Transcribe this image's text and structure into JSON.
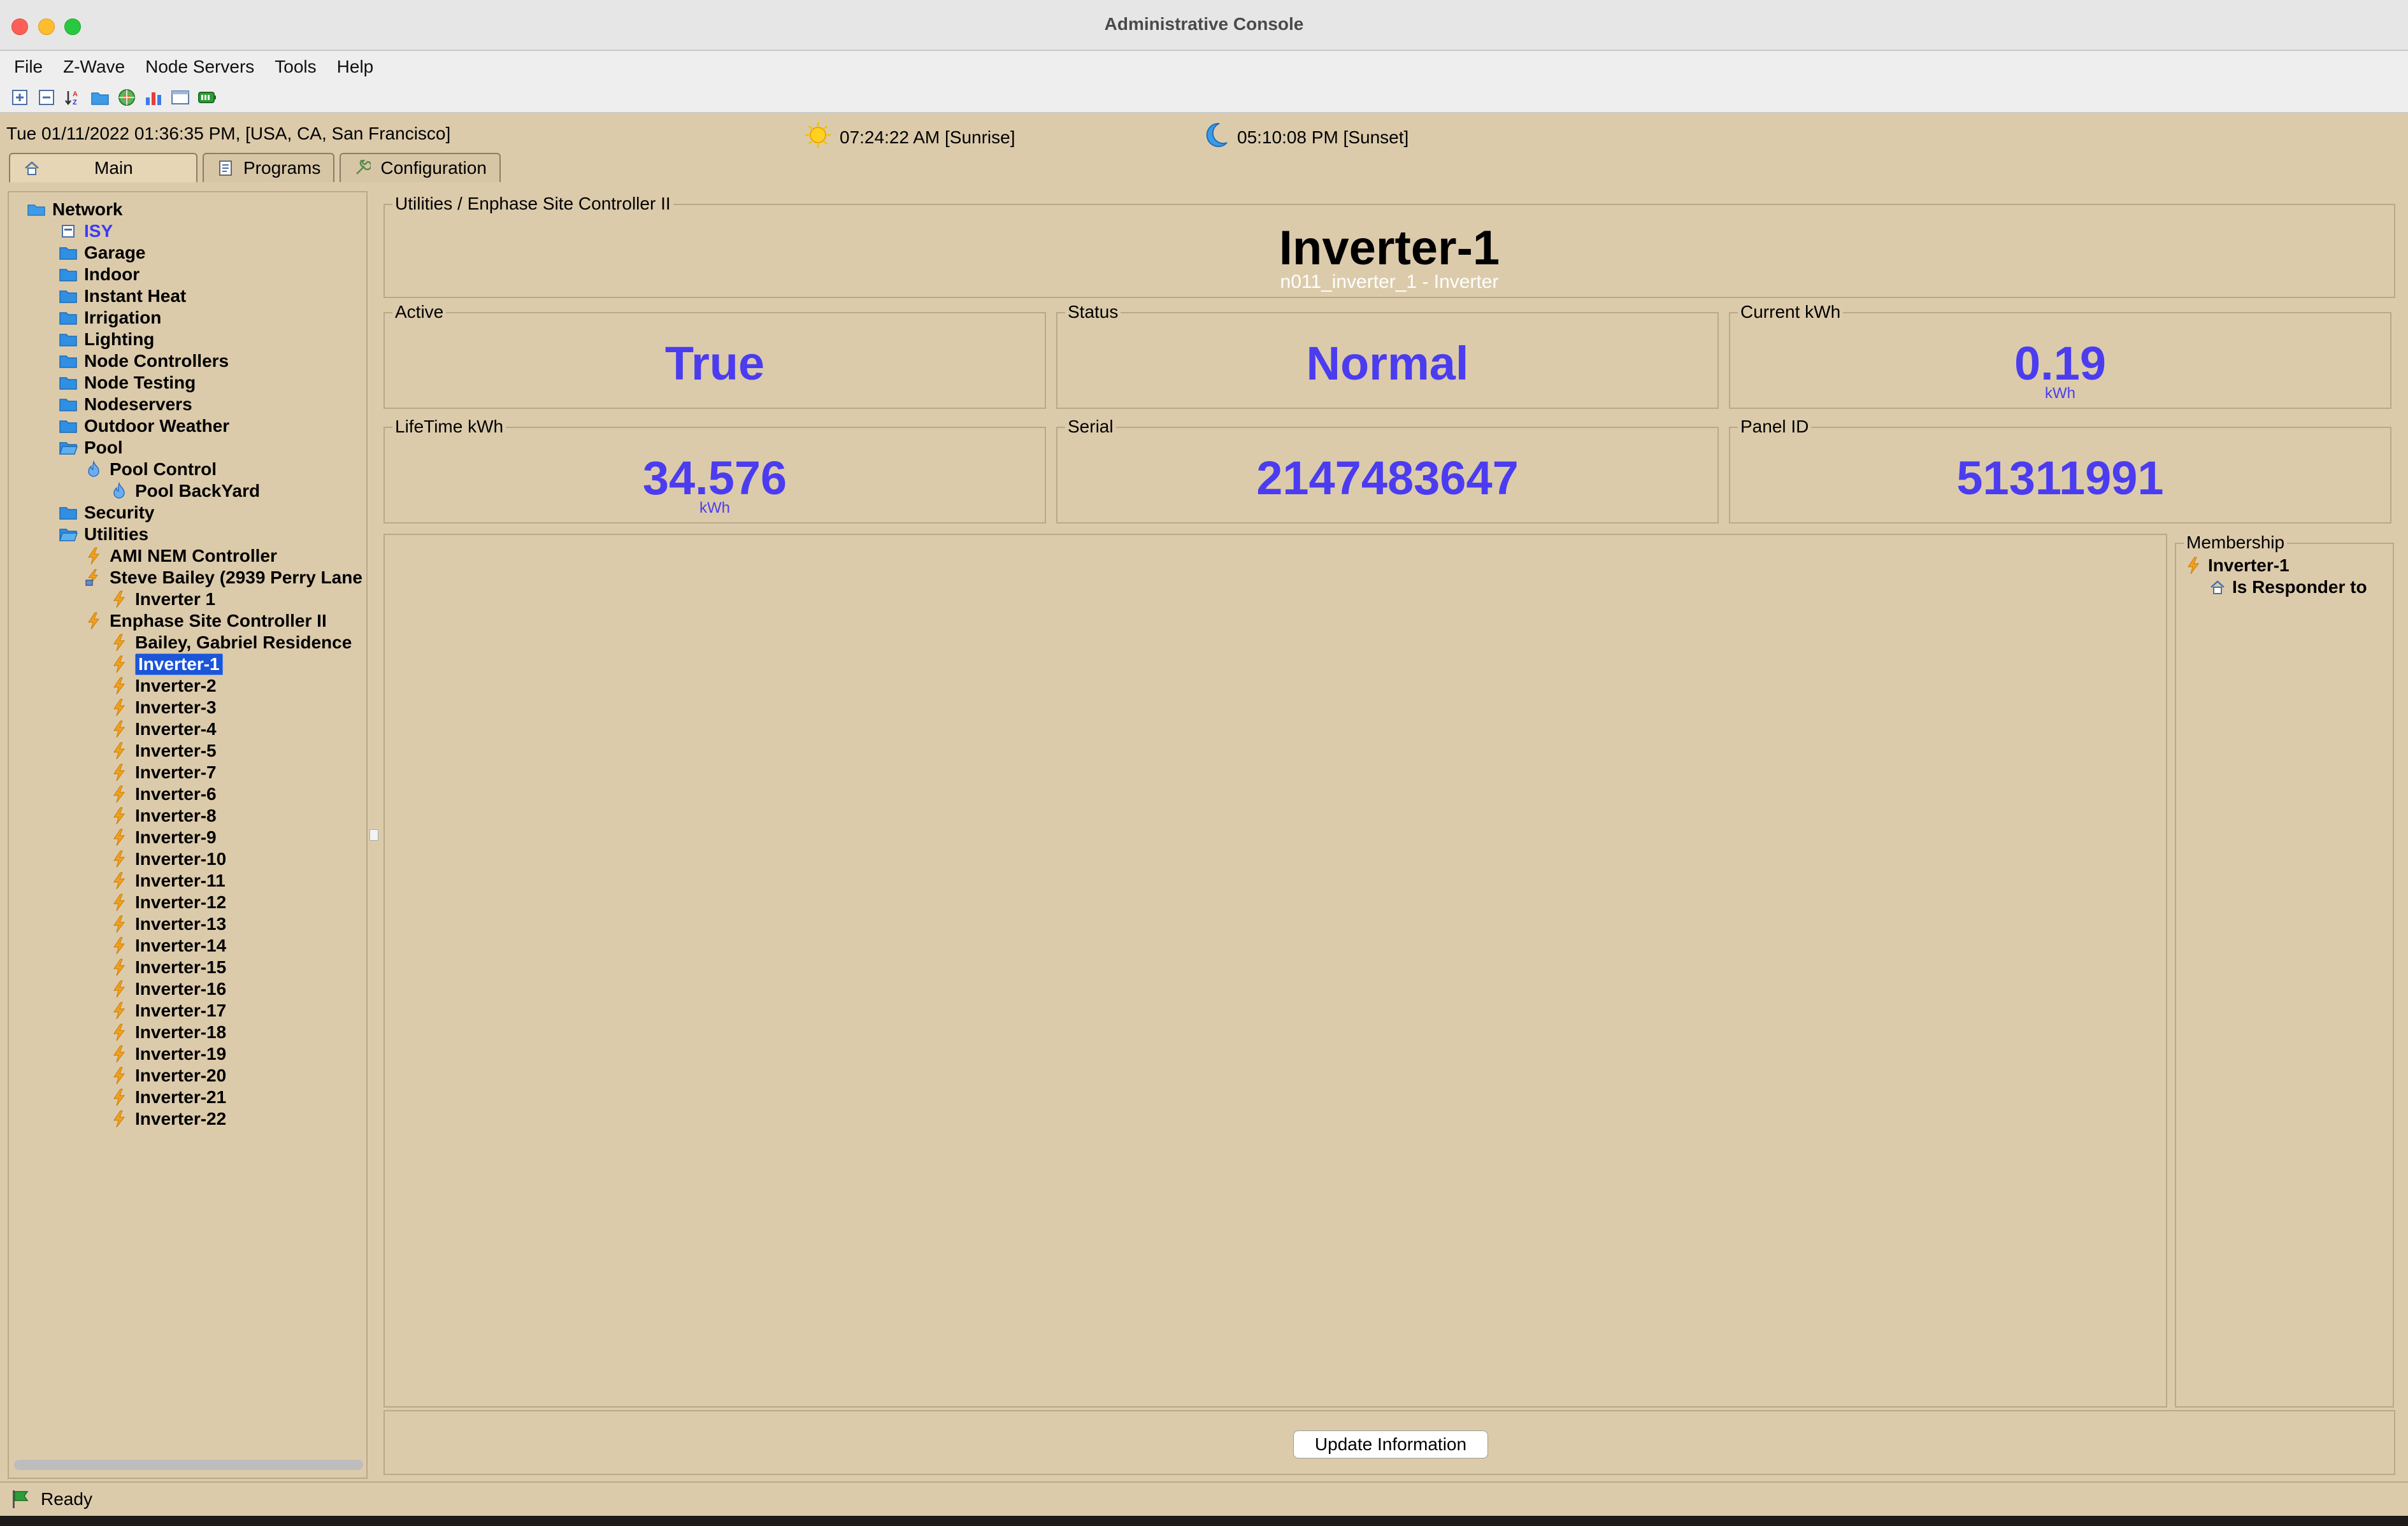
{
  "window": {
    "title": "Administrative Console"
  },
  "menu": [
    "File",
    "Z-Wave",
    "Node Servers",
    "Tools",
    "Help"
  ],
  "toolbar_icons": [
    "expand-all-icon",
    "collapse-all-icon",
    "sort-icon",
    "folder-icon",
    "network-globe-icon",
    "chart-icon",
    "window-icon",
    "battery-icon"
  ],
  "info": {
    "datetime": "Tue 01/11/2022 01:36:35 PM,  [USA, CA, San Francisco]",
    "sunrise": "07:24:22 AM [Sunrise]",
    "sunset": "05:10:08 PM [Sunset]"
  },
  "tabs": [
    {
      "label": "Main",
      "icon": "home-icon"
    },
    {
      "label": "Programs",
      "icon": "programs-icon"
    },
    {
      "label": "Configuration",
      "icon": "wrench-icon"
    }
  ],
  "tree": [
    {
      "label": "Network",
      "type": "network",
      "level": 0
    },
    {
      "label": "ISY",
      "type": "isy",
      "level": 1
    },
    {
      "label": "Garage",
      "type": "folder",
      "level": 1
    },
    {
      "label": "Indoor",
      "type": "folder",
      "level": 1
    },
    {
      "label": "Instant Heat",
      "type": "folder",
      "level": 1
    },
    {
      "label": "Irrigation",
      "type": "folder",
      "level": 1
    },
    {
      "label": "Lighting",
      "type": "folder",
      "level": 1
    },
    {
      "label": "Node Controllers",
      "type": "folder",
      "level": 1
    },
    {
      "label": "Node Testing",
      "type": "folder",
      "level": 1
    },
    {
      "label": "Nodeservers",
      "type": "folder",
      "level": 1
    },
    {
      "label": "Outdoor Weather",
      "type": "folder",
      "level": 1
    },
    {
      "label": "Pool",
      "type": "folder-open",
      "level": 1
    },
    {
      "label": "Pool Control",
      "type": "flame",
      "level": 2
    },
    {
      "label": "Pool BackYard",
      "type": "flame",
      "level": 3
    },
    {
      "label": "Security",
      "type": "folder",
      "level": 1
    },
    {
      "label": "Utilities",
      "type": "folder-open",
      "level": 1
    },
    {
      "label": "AMI NEM Controller",
      "type": "bolt",
      "level": 2
    },
    {
      "label": "Steve Bailey (2939 Perry Lane",
      "type": "meter",
      "level": 2
    },
    {
      "label": "Inverter 1",
      "type": "bolt",
      "level": 3
    },
    {
      "label": "Enphase Site Controller II",
      "type": "bolt",
      "level": 2
    },
    {
      "label": "Bailey, Gabriel Residence",
      "type": "bolt",
      "level": 3
    },
    {
      "label": "Inverter-1",
      "type": "bolt",
      "level": 3,
      "selected": true
    },
    {
      "label": "Inverter-2",
      "type": "bolt",
      "level": 3
    },
    {
      "label": "Inverter-3",
      "type": "bolt",
      "level": 3
    },
    {
      "label": "Inverter-4",
      "type": "bolt",
      "level": 3
    },
    {
      "label": "Inverter-5",
      "type": "bolt",
      "level": 3
    },
    {
      "label": "Inverter-7",
      "type": "bolt",
      "level": 3
    },
    {
      "label": "Inverter-6",
      "type": "bolt",
      "level": 3
    },
    {
      "label": "Inverter-8",
      "type": "bolt",
      "level": 3
    },
    {
      "label": "Inverter-9",
      "type": "bolt",
      "level": 3
    },
    {
      "label": "Inverter-10",
      "type": "bolt",
      "level": 3
    },
    {
      "label": "Inverter-11",
      "type": "bolt",
      "level": 3
    },
    {
      "label": "Inverter-12",
      "type": "bolt",
      "level": 3
    },
    {
      "label": "Inverter-13",
      "type": "bolt",
      "level": 3
    },
    {
      "label": "Inverter-14",
      "type": "bolt",
      "level": 3
    },
    {
      "label": "Inverter-15",
      "type": "bolt",
      "level": 3
    },
    {
      "label": "Inverter-16",
      "type": "bolt",
      "level": 3
    },
    {
      "label": "Inverter-17",
      "type": "bolt",
      "level": 3
    },
    {
      "label": "Inverter-18",
      "type": "bolt",
      "level": 3
    },
    {
      "label": "Inverter-19",
      "type": "bolt",
      "level": 3
    },
    {
      "label": "Inverter-20",
      "type": "bolt",
      "level": 3
    },
    {
      "label": "Inverter-21",
      "type": "bolt",
      "level": 3
    },
    {
      "label": "Inverter-22",
      "type": "bolt",
      "level": 3
    }
  ],
  "node": {
    "path": "Utilities / Enphase Site Controller II",
    "title": "Inverter-1",
    "subtitle": "n011_inverter_1 - Inverter"
  },
  "stats": [
    {
      "label": "Active",
      "value": "True",
      "unit": ""
    },
    {
      "label": "Status",
      "value": "Normal",
      "unit": ""
    },
    {
      "label": "Current kWh",
      "value": "0.19",
      "unit": "kWh"
    },
    {
      "label": "LifeTime kWh",
      "value": "34.576",
      "unit": "kWh"
    },
    {
      "label": "Serial",
      "value": "2147483647",
      "unit": ""
    },
    {
      "label": "Panel ID",
      "value": "51311991",
      "unit": ""
    }
  ],
  "membership": {
    "title": "Membership",
    "items": [
      {
        "label": "Inverter-1",
        "icon": "bolt"
      },
      {
        "label": "Is Responder to",
        "icon": "house"
      }
    ]
  },
  "update_button": "Update Information",
  "status": {
    "text": "Ready"
  },
  "colors": {
    "background": "#dccbab",
    "value_text": "#4b3cf0",
    "selection": "#1b55d8",
    "bolt": "#f2a11c"
  }
}
